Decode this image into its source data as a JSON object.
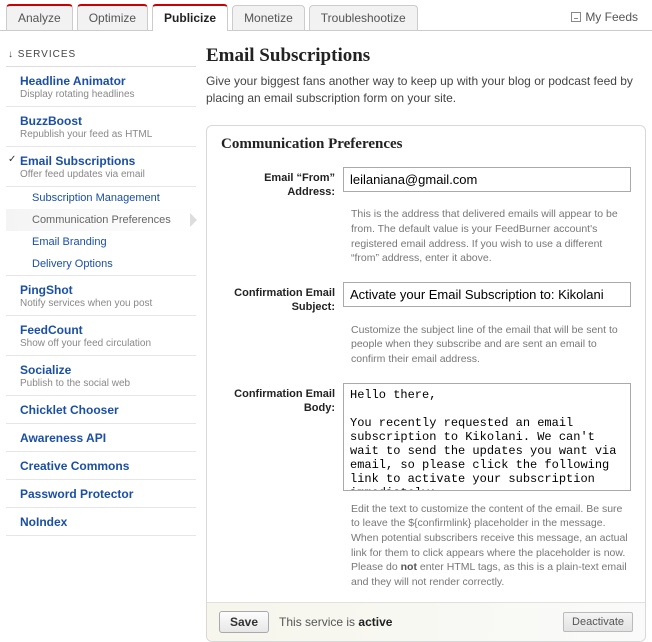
{
  "tabs": {
    "analyze": "Analyze",
    "optimize": "Optimize",
    "publicize": "Publicize",
    "monetize": "Monetize",
    "troubleshootize": "Troubleshootize"
  },
  "myfeeds": "My Feeds",
  "sidebar": {
    "header": "↓ SERVICES",
    "items": [
      {
        "title": "Headline Animator",
        "desc": "Display rotating headlines"
      },
      {
        "title": "BuzzBoost",
        "desc": "Republish your feed as HTML"
      },
      {
        "title": "Email Subscriptions",
        "desc": "Offer feed updates via email"
      },
      {
        "title": "PingShot",
        "desc": "Notify services when you post"
      },
      {
        "title": "FeedCount",
        "desc": "Show off your feed circulation"
      },
      {
        "title": "Socialize",
        "desc": "Publish to the social web"
      },
      {
        "title": "Chicklet Chooser",
        "desc": ""
      },
      {
        "title": "Awareness API",
        "desc": ""
      },
      {
        "title": "Creative Commons",
        "desc": ""
      },
      {
        "title": "Password Protector",
        "desc": ""
      },
      {
        "title": "NoIndex",
        "desc": ""
      }
    ],
    "subs": [
      "Subscription Management",
      "Communication Preferences",
      "Email Branding",
      "Delivery Options"
    ]
  },
  "page": {
    "title": "Email Subscriptions",
    "desc": "Give your biggest fans another way to keep up with your blog or podcast feed by placing an email subscription form on your site."
  },
  "panel": {
    "title": "Communication Preferences",
    "from_label": "Email “From” Address:",
    "from_value": "leilaniana@gmail.com",
    "from_help": "This is the address that delivered emails will appear to be from. The default value is your FeedBurner account's registered email address. If you wish to use a different “from” address, enter it above.",
    "subj_label": "Confirmation Email Subject:",
    "subj_value": "Activate your Email Subscription to: Kikolani",
    "subj_help": "Customize the subject line of the email that will be sent to people when they subscribe and are sent an email to confirm their email address.",
    "body_label": "Confirmation Email Body:",
    "body_value": "Hello there,\n\nYou recently requested an email subscription to Kikolani. We can't wait to send the updates you want via email, so please click the following link to activate your subscription immediately:",
    "body_help_1": "Edit the text to customize the content of the email. Be sure to leave the ${confirmlink} placeholder in the message. When potential subscribers receive this message, an actual link for them to click appears where the placeholder is now. Please do ",
    "body_help_bold": "not",
    "body_help_2": " enter HTML tags, as this is a plain-text email and they will not render correctly."
  },
  "footer": {
    "save": "Save",
    "status_1": "This service is ",
    "status_bold": "active",
    "deactivate": "Deactivate"
  }
}
